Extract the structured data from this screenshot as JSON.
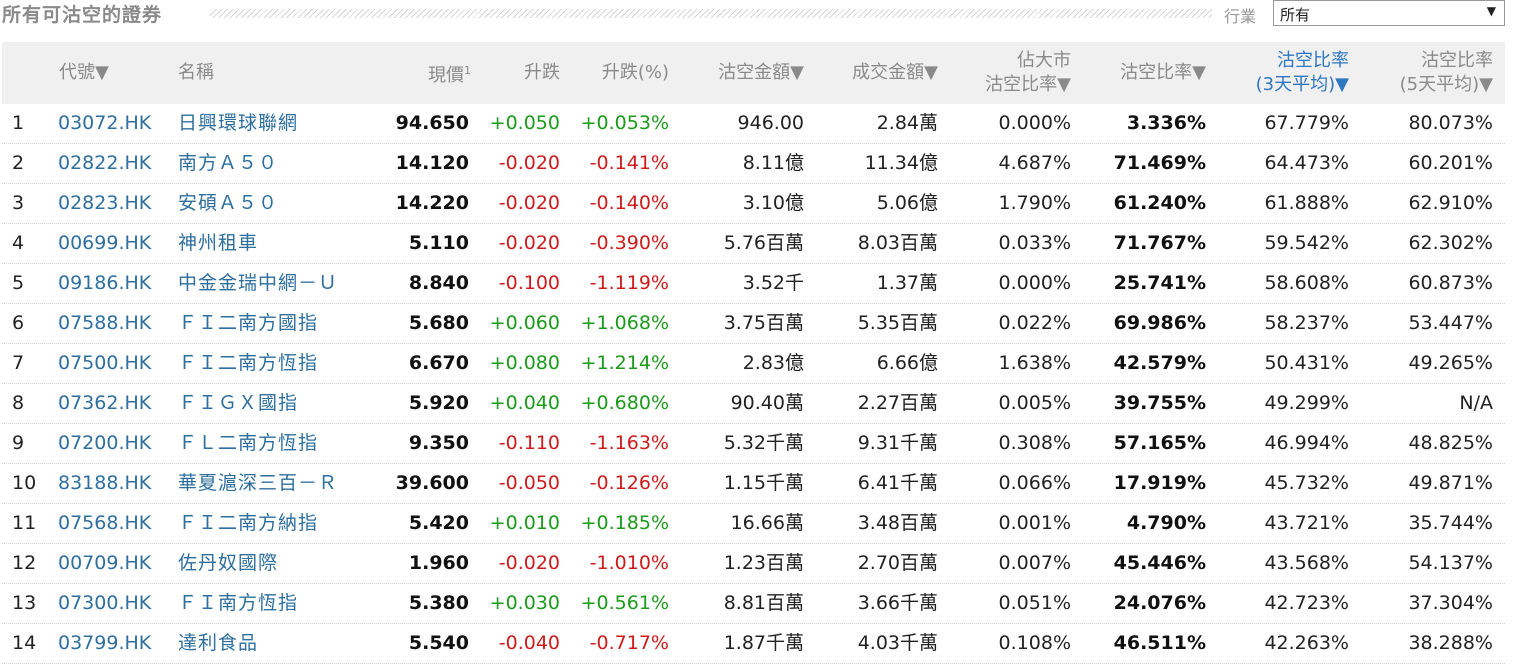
{
  "header": {
    "title": "所有可沽空的證券",
    "filter_label": "行業",
    "filter_value": "所有"
  },
  "table": {
    "columns": {
      "code": "代號▼",
      "name": "名稱",
      "price": "現價",
      "price_sup": "1",
      "change": "升跌",
      "change_pct": "升跌(%)",
      "short_amount": "沽空金額▼",
      "turnover": "成交金額▼",
      "market_ratio_l1": "佔大市",
      "market_ratio_l2": "沽空比率▼",
      "short_ratio": "沽空比率▼",
      "ratio3_l1": "沽空比率",
      "ratio3_l2": "(3天平均)▼",
      "ratio5_l1": "沽空比率",
      "ratio5_l2": "(5天平均)▼"
    },
    "rows": [
      {
        "idx": "1",
        "code": "03072.HK",
        "name": "日興環球聯網",
        "price": "94.650",
        "change": "+0.050",
        "change_pct": "+0.053%",
        "dir": "up",
        "amount": "946.00",
        "turnover": "2.84萬",
        "market_ratio": "0.000%",
        "short_ratio": "3.336%",
        "avg3": "67.779%",
        "avg5": "80.073%"
      },
      {
        "idx": "2",
        "code": "02822.HK",
        "name": "南方Ａ５０",
        "price": "14.120",
        "change": "-0.020",
        "change_pct": "-0.141%",
        "dir": "down",
        "amount": "8.11億",
        "turnover": "11.34億",
        "market_ratio": "4.687%",
        "short_ratio": "71.469%",
        "avg3": "64.473%",
        "avg5": "60.201%"
      },
      {
        "idx": "3",
        "code": "02823.HK",
        "name": "安碩Ａ５０",
        "price": "14.220",
        "change": "-0.020",
        "change_pct": "-0.140%",
        "dir": "down",
        "amount": "3.10億",
        "turnover": "5.06億",
        "market_ratio": "1.790%",
        "short_ratio": "61.240%",
        "avg3": "61.888%",
        "avg5": "62.910%"
      },
      {
        "idx": "4",
        "code": "00699.HK",
        "name": "神州租車",
        "price": "5.110",
        "change": "-0.020",
        "change_pct": "-0.390%",
        "dir": "down",
        "amount": "5.76百萬",
        "turnover": "8.03百萬",
        "market_ratio": "0.033%",
        "short_ratio": "71.767%",
        "avg3": "59.542%",
        "avg5": "62.302%"
      },
      {
        "idx": "5",
        "code": "09186.HK",
        "name": "中金金瑞中網－Ｕ",
        "price": "8.840",
        "change": "-0.100",
        "change_pct": "-1.119%",
        "dir": "down",
        "amount": "3.52千",
        "turnover": "1.37萬",
        "market_ratio": "0.000%",
        "short_ratio": "25.741%",
        "avg3": "58.608%",
        "avg5": "60.873%"
      },
      {
        "idx": "6",
        "code": "07588.HK",
        "name": "ＦＩ二南方國指",
        "price": "5.680",
        "change": "+0.060",
        "change_pct": "+1.068%",
        "dir": "up",
        "amount": "3.75百萬",
        "turnover": "5.35百萬",
        "market_ratio": "0.022%",
        "short_ratio": "69.986%",
        "avg3": "58.237%",
        "avg5": "53.447%"
      },
      {
        "idx": "7",
        "code": "07500.HK",
        "name": "ＦＩ二南方恆指",
        "price": "6.670",
        "change": "+0.080",
        "change_pct": "+1.214%",
        "dir": "up",
        "amount": "2.83億",
        "turnover": "6.66億",
        "market_ratio": "1.638%",
        "short_ratio": "42.579%",
        "avg3": "50.431%",
        "avg5": "49.265%"
      },
      {
        "idx": "8",
        "code": "07362.HK",
        "name": "ＦＩＧＸ國指",
        "price": "5.920",
        "change": "+0.040",
        "change_pct": "+0.680%",
        "dir": "up",
        "amount": "90.40萬",
        "turnover": "2.27百萬",
        "market_ratio": "0.005%",
        "short_ratio": "39.755%",
        "avg3": "49.299%",
        "avg5": "N/A"
      },
      {
        "idx": "9",
        "code": "07200.HK",
        "name": "ＦＬ二南方恆指",
        "price": "9.350",
        "change": "-0.110",
        "change_pct": "-1.163%",
        "dir": "down",
        "amount": "5.32千萬",
        "turnover": "9.31千萬",
        "market_ratio": "0.308%",
        "short_ratio": "57.165%",
        "avg3": "46.994%",
        "avg5": "48.825%"
      },
      {
        "idx": "10",
        "code": "83188.HK",
        "name": "華夏滬深三百－Ｒ",
        "price": "39.600",
        "change": "-0.050",
        "change_pct": "-0.126%",
        "dir": "down",
        "amount": "1.15千萬",
        "turnover": "6.41千萬",
        "market_ratio": "0.066%",
        "short_ratio": "17.919%",
        "avg3": "45.732%",
        "avg5": "49.871%"
      },
      {
        "idx": "11",
        "code": "07568.HK",
        "name": "ＦＩ二南方納指",
        "price": "5.420",
        "change": "+0.010",
        "change_pct": "+0.185%",
        "dir": "up",
        "amount": "16.66萬",
        "turnover": "3.48百萬",
        "market_ratio": "0.001%",
        "short_ratio": "4.790%",
        "avg3": "43.721%",
        "avg5": "35.744%"
      },
      {
        "idx": "12",
        "code": "00709.HK",
        "name": "佐丹奴國際",
        "price": "1.960",
        "change": "-0.020",
        "change_pct": "-1.010%",
        "dir": "down",
        "amount": "1.23百萬",
        "turnover": "2.70百萬",
        "market_ratio": "0.007%",
        "short_ratio": "45.446%",
        "avg3": "43.568%",
        "avg5": "54.137%"
      },
      {
        "idx": "13",
        "code": "07300.HK",
        "name": "ＦＩ南方恆指",
        "price": "5.380",
        "change": "+0.030",
        "change_pct": "+0.561%",
        "dir": "up",
        "amount": "8.81百萬",
        "turnover": "3.66千萬",
        "market_ratio": "0.051%",
        "short_ratio": "24.076%",
        "avg3": "42.723%",
        "avg5": "37.304%"
      },
      {
        "idx": "14",
        "code": "03799.HK",
        "name": "達利食品",
        "price": "5.540",
        "change": "-0.040",
        "change_pct": "-0.717%",
        "dir": "down",
        "amount": "1.87千萬",
        "turnover": "4.03千萬",
        "market_ratio": "0.108%",
        "short_ratio": "46.511%",
        "avg3": "42.263%",
        "avg5": "38.288%"
      }
    ]
  },
  "colors": {
    "up": "#1a9c1a",
    "down": "#d01b1b",
    "link": "#2e6f9e",
    "sort_active": "#2e77c1",
    "header_bg": "#f0f0f0"
  }
}
